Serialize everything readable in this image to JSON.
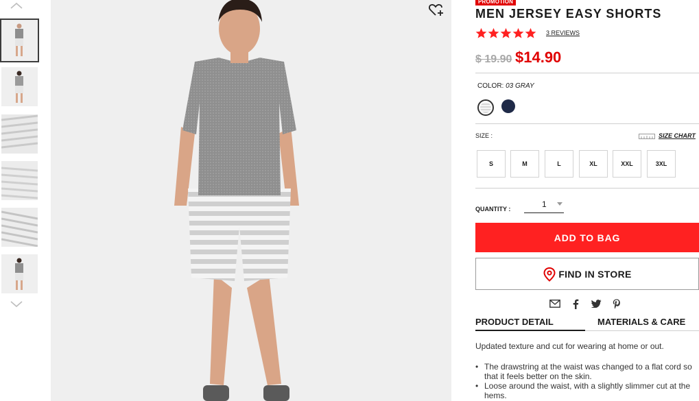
{
  "product": {
    "promo_badge": "PROMOTION",
    "title": "MEN JERSEY EASY SHORTS",
    "rating": 5,
    "reviews_label": "3 REVIEWS",
    "old_price": "$ 19.90",
    "new_price": "$14.90"
  },
  "color": {
    "label": "COLOR:",
    "selected": "03 GRAY",
    "swatches": [
      "#d8d8d8",
      "#1f2a48"
    ]
  },
  "size": {
    "label": "SIZE :",
    "chart_label": "SIZE CHART",
    "options": [
      "S",
      "M",
      "L",
      "XL",
      "XXL",
      "3XL"
    ]
  },
  "quantity": {
    "label": "QUANTITY :",
    "value": "1"
  },
  "actions": {
    "add_to_bag": "ADD TO BAG",
    "find_in_store": "FIND IN STORE"
  },
  "share_icons": [
    "mail-icon",
    "facebook-icon",
    "twitter-icon",
    "pinterest-icon"
  ],
  "tabs": {
    "detail": "PRODUCT DETAIL",
    "materials": "MATERIALS & CARE"
  },
  "description": {
    "intro": "Updated texture and cut for wearing at home or out.",
    "bullets": [
      "The drawstring at the waist was changed to a flat cord so that it feels better on the skin.",
      "Loose around the waist, with a slightly slimmer cut at the hems."
    ]
  },
  "colors": {
    "accent_red": "#ff2121",
    "price_red": "#e00000",
    "image_bg": "#efefef"
  }
}
